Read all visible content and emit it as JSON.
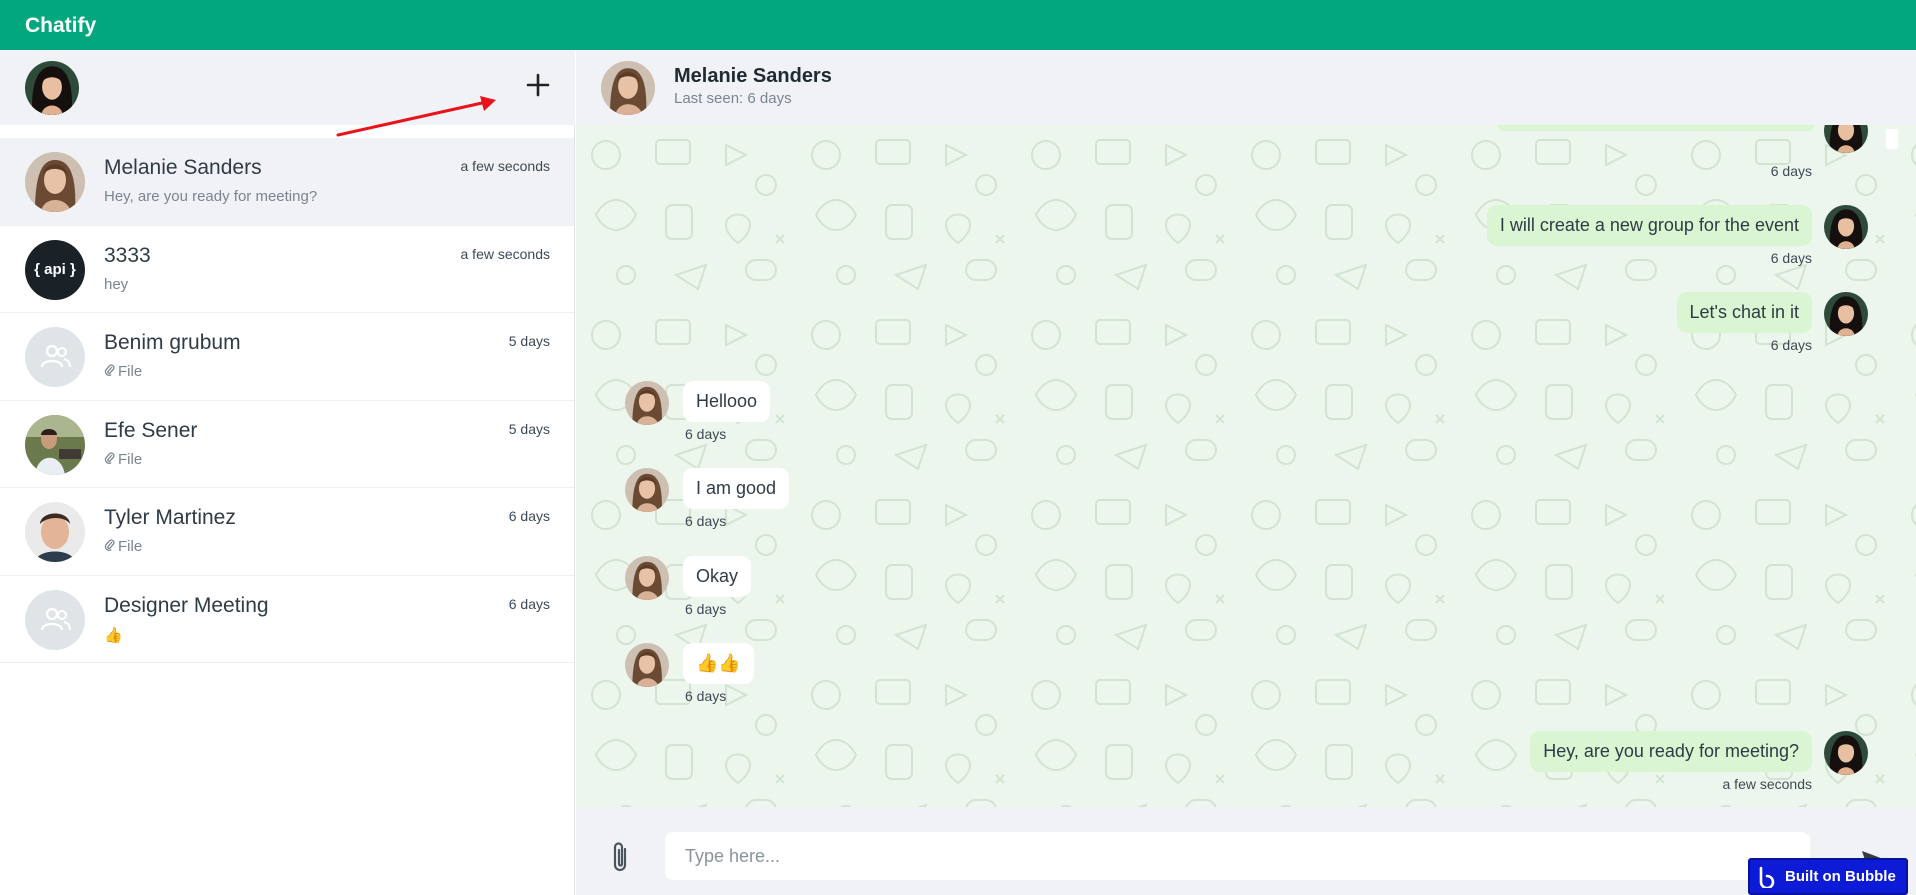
{
  "app": {
    "title": "Chatify"
  },
  "sidebar": {
    "new_chat_icon": "plus-icon",
    "chats": [
      {
        "name": "Melanie Sanders",
        "time": "a few seconds",
        "preview": "Hey, are you ready for meeting?",
        "avatar": "photo-woman-brown-hair",
        "active": true,
        "attachment": false
      },
      {
        "name": "3333",
        "time": "a few seconds",
        "preview": "hey",
        "avatar": "api-logo",
        "avatar_text": "{ api }",
        "active": false,
        "attachment": false
      },
      {
        "name": "Benim grubum",
        "time": "5 days",
        "preview": "File",
        "avatar": "group-icon",
        "active": false,
        "attachment": true
      },
      {
        "name": "Efe Sener",
        "time": "5 days",
        "preview": "File",
        "avatar": "photo-man-outdoor",
        "active": false,
        "attachment": true
      },
      {
        "name": "Tyler Martinez",
        "time": "6 days",
        "preview": "File",
        "avatar": "photo-man-short-hair",
        "active": false,
        "attachment": true
      },
      {
        "name": "Designer Meeting",
        "time": "6 days",
        "preview": "👍",
        "avatar": "group-icon",
        "active": false,
        "attachment": false
      }
    ]
  },
  "chat": {
    "contact_name": "Melanie Sanders",
    "status": "Last seen: 6 days",
    "messages": [
      {
        "direction": "out",
        "text": "",
        "time": "6 days"
      },
      {
        "direction": "out",
        "text": "I will create a new group for the event",
        "time": "6 days"
      },
      {
        "direction": "out",
        "text": "Let's chat in it",
        "time": "6 days"
      },
      {
        "direction": "in",
        "text": "Hellooo",
        "time": "6 days"
      },
      {
        "direction": "in",
        "text": "I am good",
        "time": "6 days"
      },
      {
        "direction": "in",
        "text": "Okay",
        "time": "6 days"
      },
      {
        "direction": "in",
        "text": "👍👍",
        "time": "6 days"
      },
      {
        "direction": "out",
        "text": "Hey, are you ready for meeting?",
        "time": "a few seconds"
      }
    ]
  },
  "composer": {
    "placeholder": "Type here...",
    "attach_icon": "paperclip-icon",
    "send_icon": "send-icon"
  },
  "badge": {
    "label": "Built on Bubble"
  },
  "colors": {
    "brand": "#02a77e",
    "incoming_bubble": "#ffffff",
    "outgoing_bubble": "#d9f5d2",
    "chat_background": "#edf6ec",
    "annotation_arrow": "#e8131b",
    "badge": "#0d1bd6"
  }
}
